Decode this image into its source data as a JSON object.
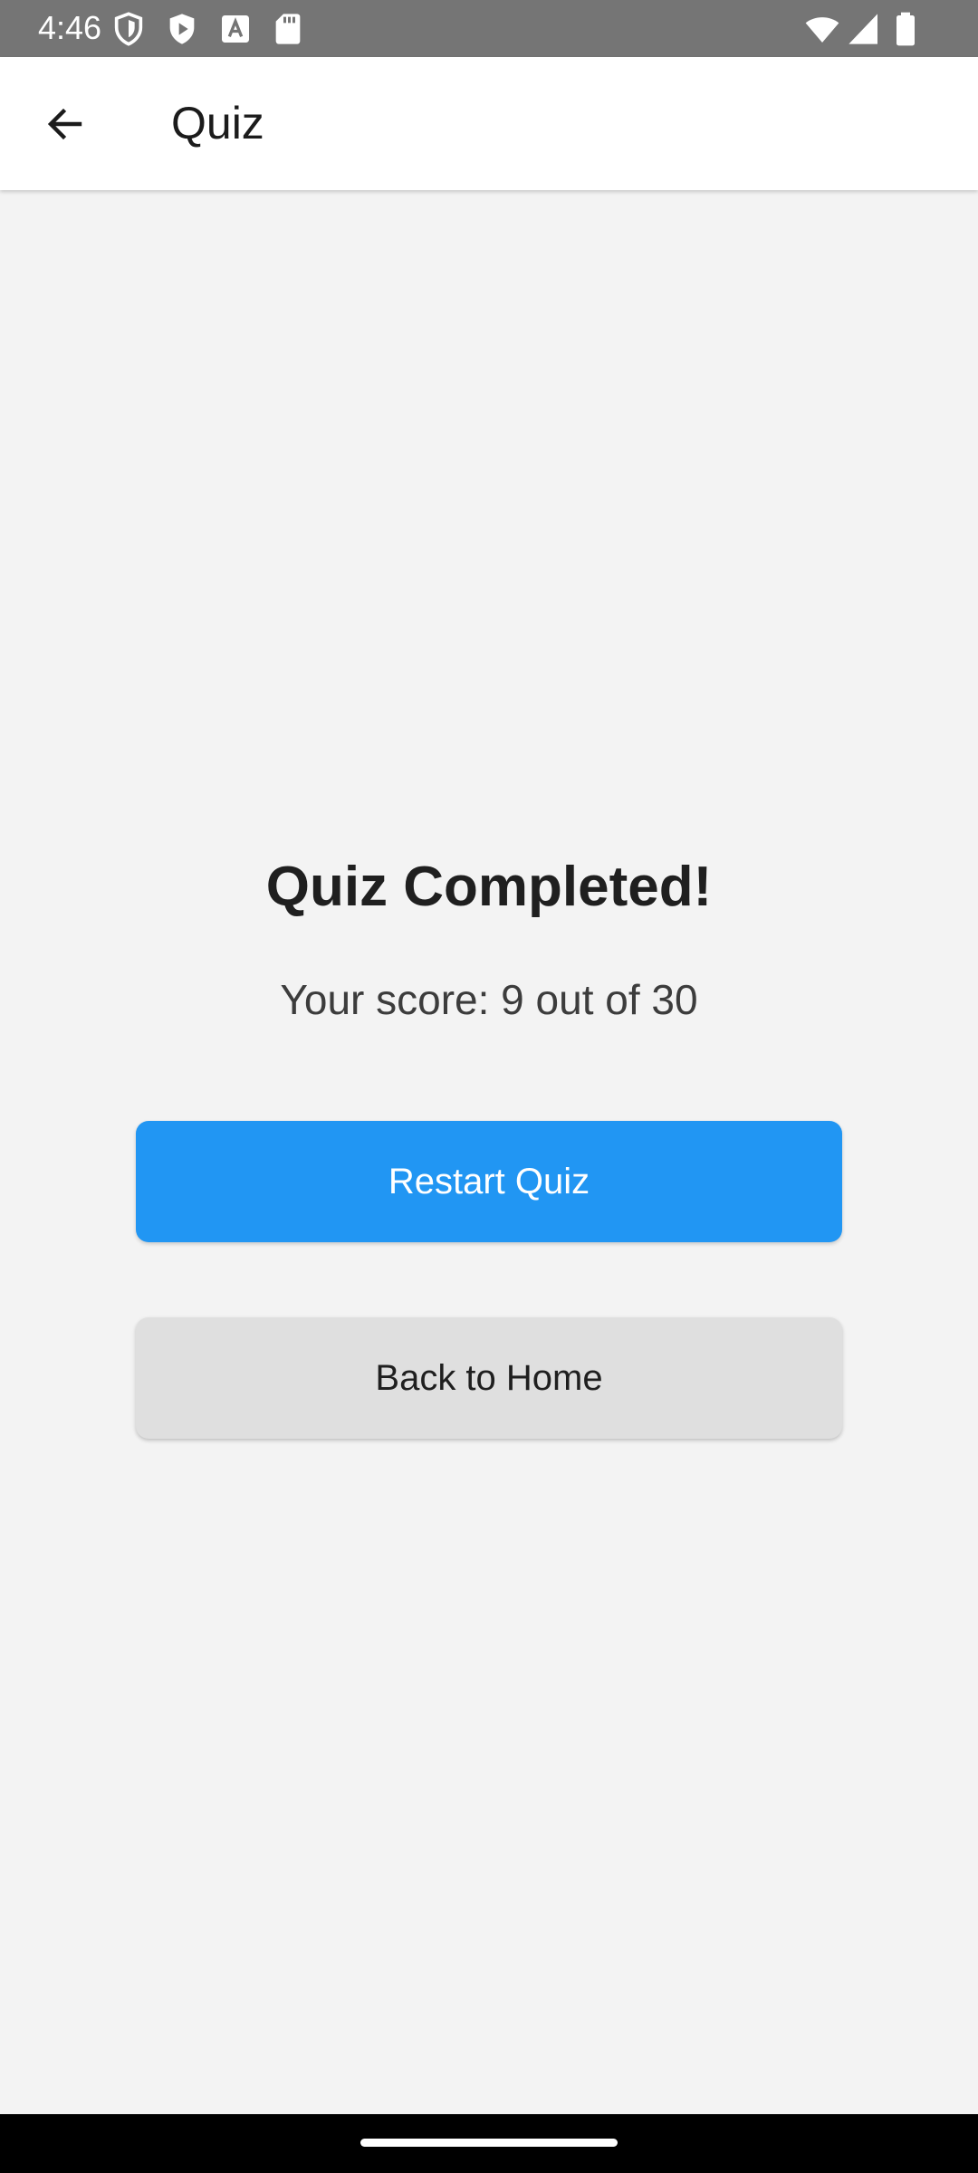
{
  "status_bar": {
    "time": "4:46",
    "left_icons": [
      "shield-icon",
      "play-store-icon",
      "text-a-icon",
      "sd-card-icon"
    ],
    "right_icons": [
      "wifi-icon",
      "cellular-signal-icon",
      "battery-icon"
    ]
  },
  "app_bar": {
    "back_icon": "arrow-left-icon",
    "title": "Quiz"
  },
  "result": {
    "title": "Quiz Completed!",
    "score_text": "Your score: 9 out of 30",
    "score": 9,
    "total": 30
  },
  "buttons": {
    "restart_label": "Restart Quiz",
    "home_label": "Back to Home"
  },
  "colors": {
    "primary": "#2196f3",
    "secondary_button": "#dfdfdf",
    "background": "#f3f3f3",
    "status_bar": "#757575"
  }
}
